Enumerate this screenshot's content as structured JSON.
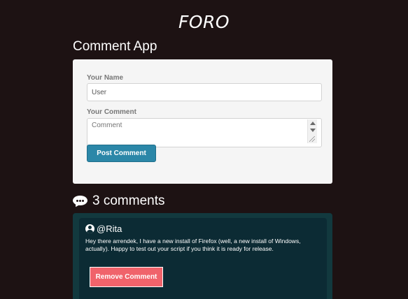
{
  "site": {
    "title": "FORO"
  },
  "app": {
    "title": "Comment App"
  },
  "form": {
    "name_label": "Your Name",
    "name_value": "User",
    "comment_label": "Your Comment",
    "comment_placeholder": "Comment",
    "submit_label": "Post Comment"
  },
  "comments": {
    "heading": "3 comments",
    "icon": "comments-icon",
    "items": [
      {
        "author": "@Rita",
        "text": "Hey there arrendek, I have a new install of Firefox (well, a new install of Windows, actually). Happy to test out your script if you think it is ready for release.",
        "remove_label": "Remove Comment"
      }
    ]
  },
  "colors": {
    "background": "#1d1213",
    "card": "#f5f5f5",
    "primary_button": "#2b87a8",
    "danger_button": "#f0636b",
    "comments_panel": "#12393e",
    "comment_card": "#0c2b34"
  }
}
